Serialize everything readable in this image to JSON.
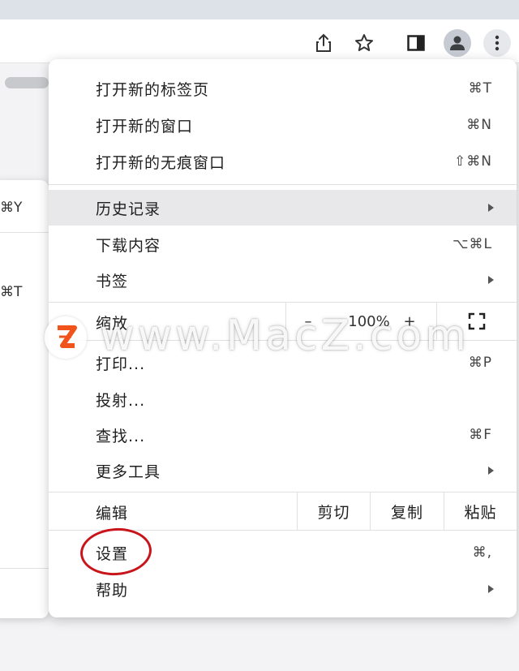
{
  "toolbar": {
    "share_icon": "share-icon",
    "bookmark_icon": "star-icon",
    "side_panel_icon": "side-panel-icon",
    "profile_icon": "person-icon",
    "menu_icon": "kebab-icon"
  },
  "submenu": {
    "shortcut_history": "⌘Y",
    "shortcut_other": "⌘T"
  },
  "menu": {
    "new_tab": {
      "label": "打开新的标签页",
      "shortcut": "⌘T"
    },
    "new_window": {
      "label": "打开新的窗口",
      "shortcut": "⌘N"
    },
    "new_incognito": {
      "label": "打开新的无痕窗口",
      "shortcut": "⇧⌘N"
    },
    "history": {
      "label": "历史记录"
    },
    "downloads": {
      "label": "下载内容",
      "shortcut": "⌥⌘L"
    },
    "bookmarks": {
      "label": "书签"
    },
    "zoom": {
      "label": "缩放",
      "minus": "–",
      "value": "100%",
      "plus": "+"
    },
    "print": {
      "label": "打印...",
      "shortcut": "⌘P"
    },
    "cast": {
      "label": "投射..."
    },
    "find": {
      "label": "查找...",
      "shortcut": "⌘F"
    },
    "more_tools": {
      "label": "更多工具"
    },
    "edit": {
      "label": "编辑",
      "cut": "剪切",
      "copy": "复制",
      "paste": "粘贴"
    },
    "settings": {
      "label": "设置",
      "shortcut": "⌘,"
    },
    "help": {
      "label": "帮助"
    }
  },
  "watermark": {
    "logo": "Z",
    "text": "www.MacZ.com"
  },
  "colors": {
    "highlight_circle": "#c8141b",
    "active_row": "#e8e8ea",
    "logo_orange": "#f0531c"
  }
}
